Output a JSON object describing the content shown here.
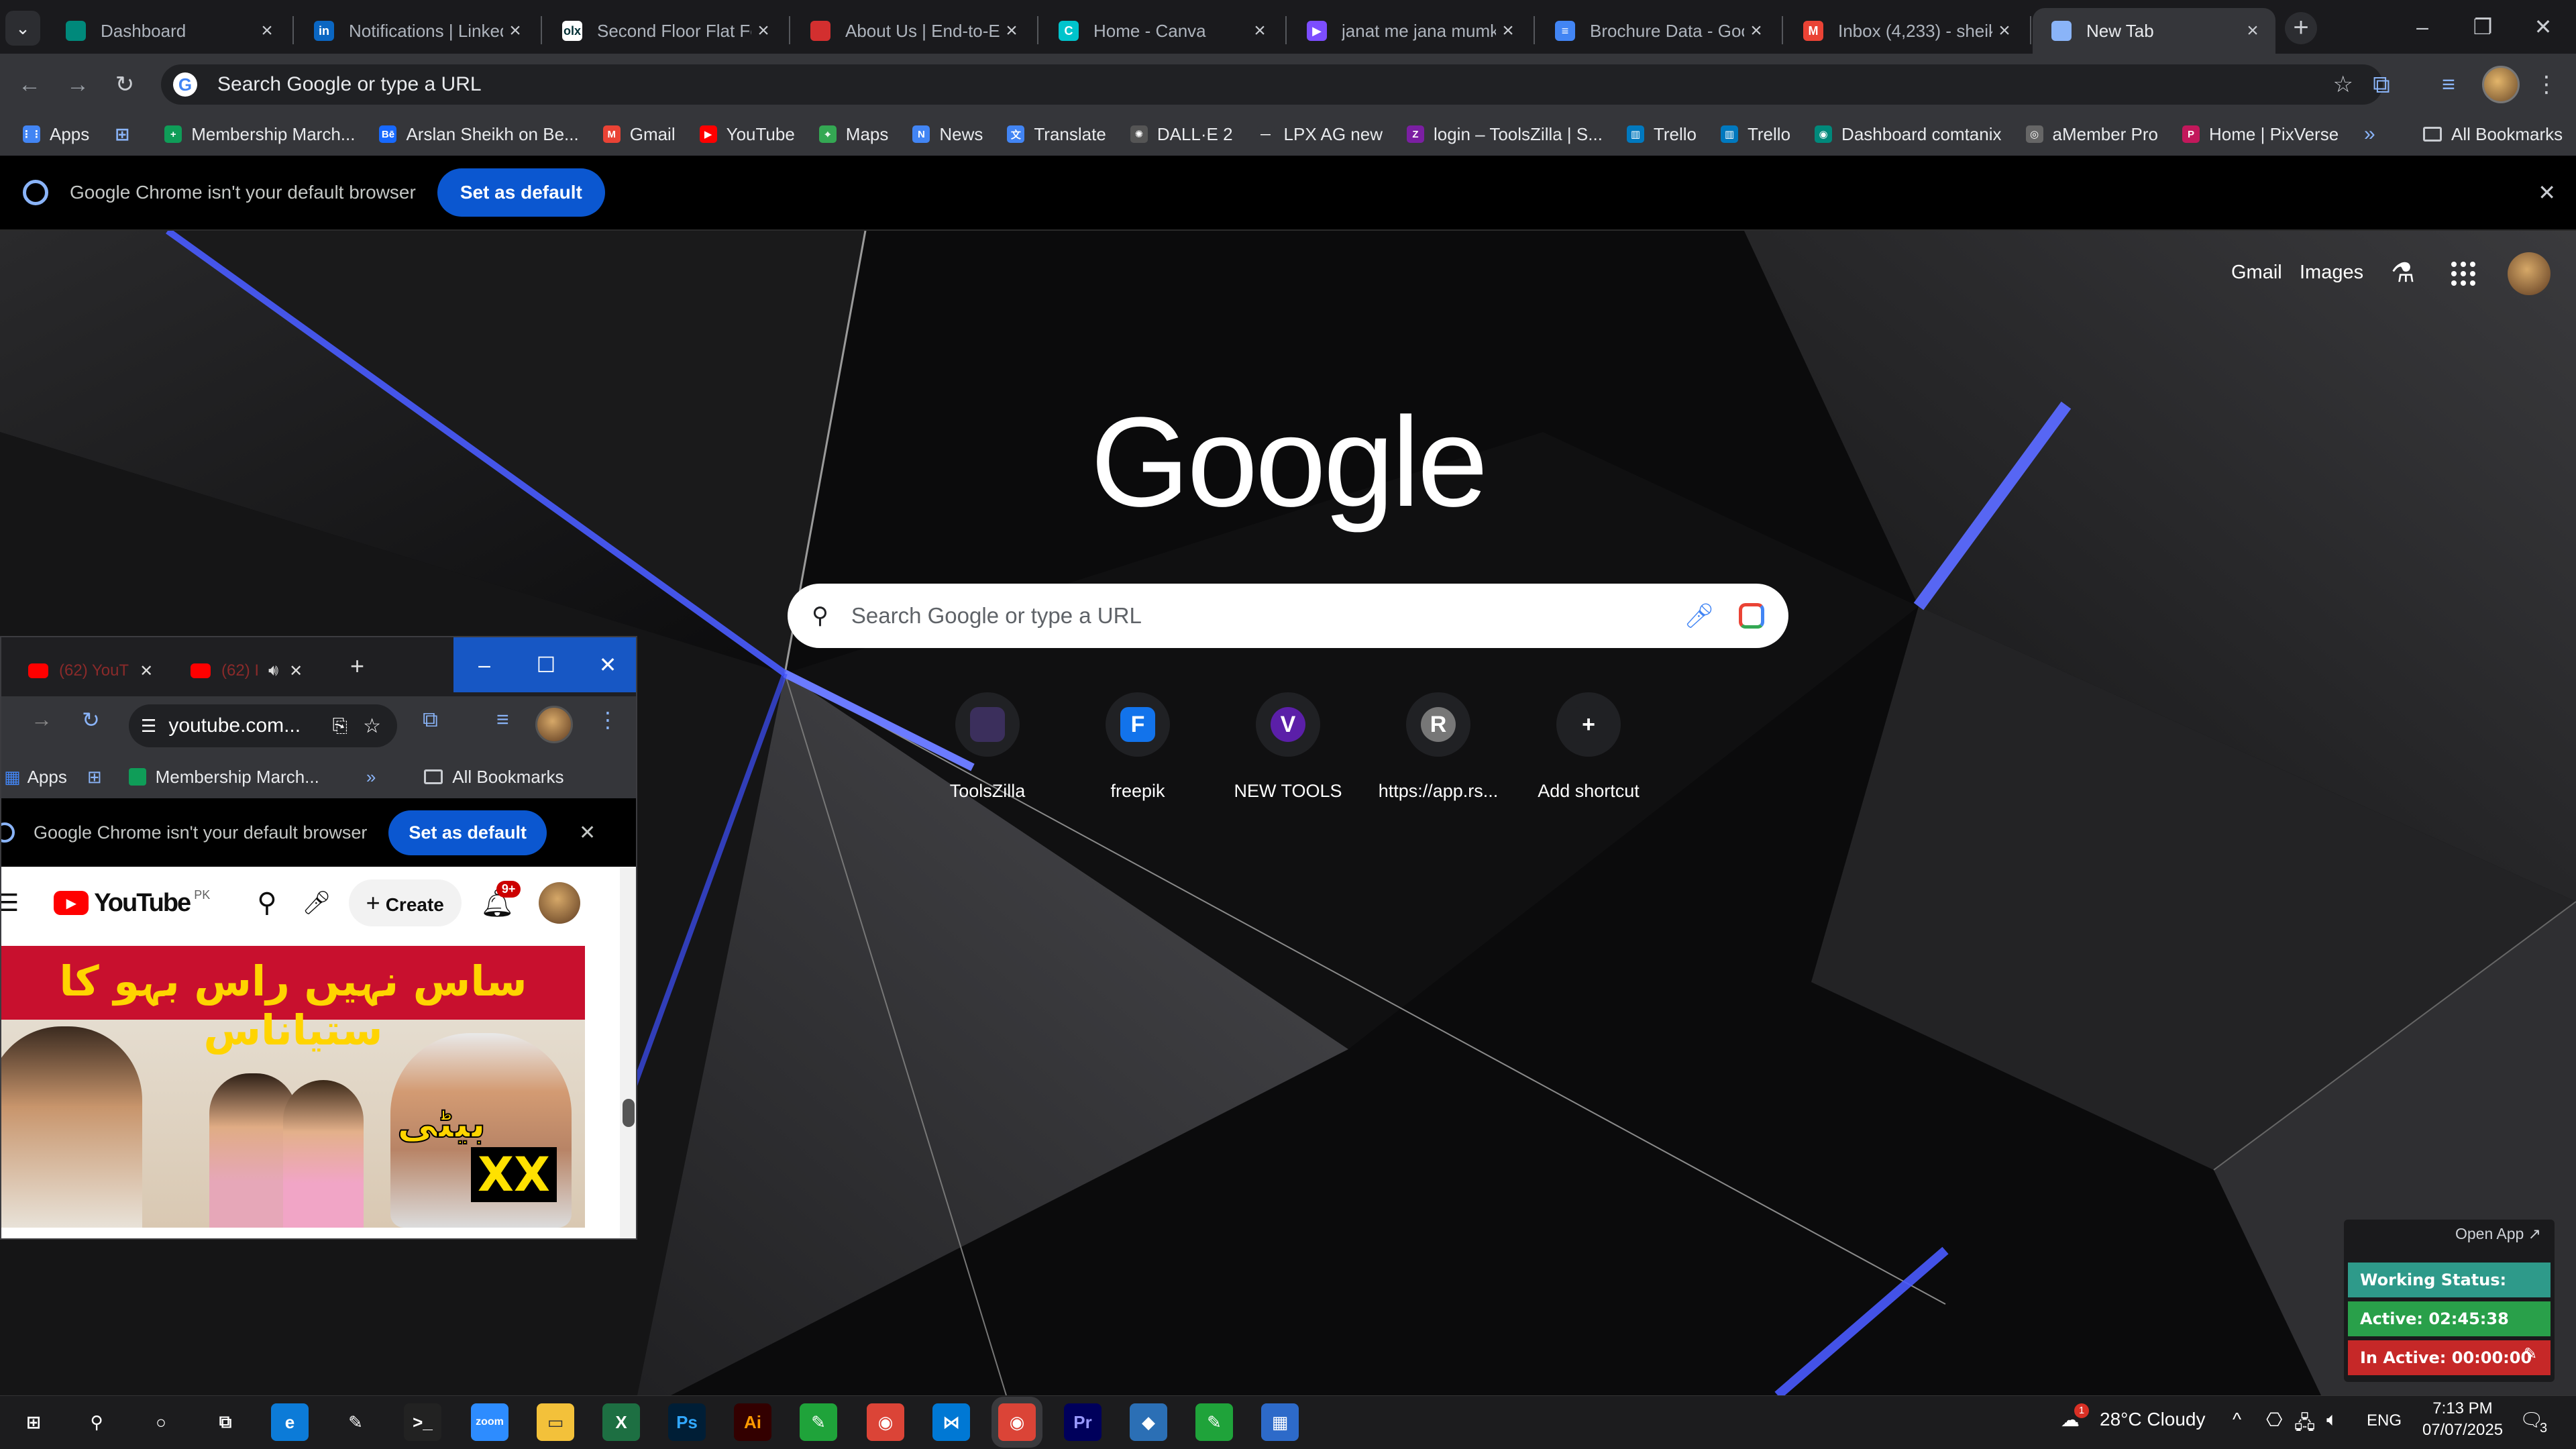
{
  "browser": {
    "tabs": [
      {
        "label": "Dashboard",
        "icon": "globe-teal"
      },
      {
        "label": "Notifications | LinkedIn",
        "icon": "linkedin"
      },
      {
        "label": "Second Floor Flat For",
        "icon": "olx"
      },
      {
        "label": "About Us | End-to-End",
        "icon": "red-diamond"
      },
      {
        "label": "Home - Canva",
        "icon": "canva"
      },
      {
        "label": "janat me jana mumkin",
        "icon": "video-purple"
      },
      {
        "label": "Brochure Data - Google",
        "icon": "docs"
      },
      {
        "label": "Inbox (4,233) - sheikh",
        "icon": "gmail"
      },
      {
        "label": "New Tab",
        "icon": "chrome",
        "active": true
      }
    ],
    "omnibox_placeholder": "Search Google or type a URL",
    "bookmarks": [
      {
        "label": "Apps",
        "icon": "apps-grid"
      },
      {
        "label": "",
        "icon": "grid-icon"
      },
      {
        "label": "Membership March...",
        "icon": "sheets"
      },
      {
        "label": "Arslan Sheikh on Be...",
        "icon": "behance"
      },
      {
        "label": "Gmail",
        "icon": "gmail"
      },
      {
        "label": "YouTube",
        "icon": "youtube"
      },
      {
        "label": "Maps",
        "icon": "maps"
      },
      {
        "label": "News",
        "icon": "news"
      },
      {
        "label": "Translate",
        "icon": "translate"
      },
      {
        "label": "DALL·E 2",
        "icon": "openai"
      },
      {
        "label": "LPX AG new",
        "icon": "dash"
      },
      {
        "label": "login – ToolsZilla | S...",
        "icon": "toolszilla"
      },
      {
        "label": "Trello",
        "icon": "trello"
      },
      {
        "label": "Trello",
        "icon": "trello"
      },
      {
        "label": "Dashboard comtanix",
        "icon": "globe-teal"
      },
      {
        "label": "aMember Pro",
        "icon": "globe"
      },
      {
        "label": "Home | PixVerse",
        "icon": "pixverse"
      }
    ],
    "all_bookmarks": "All Bookmarks",
    "infobar": {
      "text": "Google Chrome isn't your default browser",
      "button": "Set as default"
    }
  },
  "ntp": {
    "top_links": [
      "Gmail",
      "Images"
    ],
    "logo": "Google",
    "search_placeholder": "Search Google or type a URL",
    "shortcuts": [
      {
        "label": "ToolsZilla",
        "letter": "",
        "color": "#3b2f5c"
      },
      {
        "label": "freepik",
        "letter": "F",
        "color": "#1273eb"
      },
      {
        "label": "NEW TOOLS",
        "letter": "V",
        "color": "#5b1fa8"
      },
      {
        "label": "https://app.rs...",
        "letter": "R",
        "color": "#777777"
      },
      {
        "label": "Add shortcut",
        "letter": "+",
        "color": "#202124"
      }
    ]
  },
  "mini_window": {
    "tabs": [
      {
        "label": "(62) YouT"
      },
      {
        "label": "(62) I"
      }
    ],
    "url": "youtube.com...",
    "bookmarks": [
      "Apps",
      "Membership March..."
    ],
    "all_bookmarks": "All Bookmarks",
    "infobar": {
      "text": "Google Chrome isn't your default browser",
      "button": "Set as default"
    },
    "youtube": {
      "logo": "YouTube",
      "country": "PK",
      "create": "Create",
      "notif_badge": "9+",
      "thumb_title_urdu": "ساس نہیں راس بہو کا ستیاناس",
      "thumb_side_urdu": "بیٹی",
      "thumb_badge": "XX"
    }
  },
  "tracker": {
    "open_app": "Open App ↗",
    "working": "Working Status: Active",
    "active": "Active: 02:45:38",
    "inactive": "In Active: 00:00:00",
    "colors": {
      "working": "#2e9a8a",
      "active": "#29a04a",
      "inactive": "#c62828"
    }
  },
  "taskbar": {
    "apps": [
      "windows-start",
      "search",
      "cortana",
      "task-view",
      "edge",
      "pen-tool",
      "terminal",
      "zoom",
      "file-explorer",
      "excel",
      "photoshop",
      "illustrator",
      "app-green",
      "chrome",
      "vscode",
      "chrome-active",
      "premiere",
      "app-blue",
      "app-green-2",
      "calculator"
    ],
    "weather": "28°C  Cloudy",
    "weather_badge": "1",
    "lang": "ENG",
    "time": "7:13 PM",
    "date": "07/07/2025",
    "notif_count": "3"
  }
}
